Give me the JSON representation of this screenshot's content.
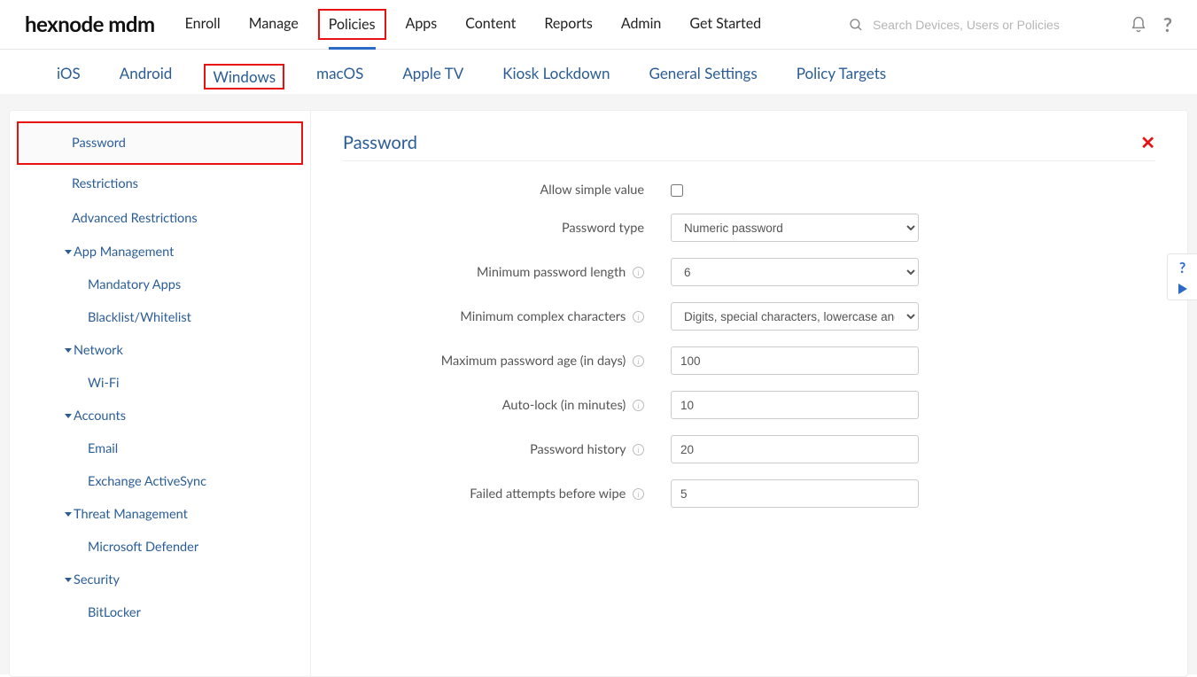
{
  "logo": "hexnode mdm",
  "search": {
    "placeholder": "Search Devices, Users or Policies"
  },
  "mainNav": {
    "items": [
      "Enroll",
      "Manage",
      "Policies",
      "Apps",
      "Content",
      "Reports",
      "Admin",
      "Get Started"
    ],
    "activeIndex": 2,
    "highlightIndex": 2
  },
  "subNav": {
    "items": [
      "iOS",
      "Android",
      "Windows",
      "macOS",
      "Apple TV",
      "Kiosk Lockdown",
      "General Settings",
      "Policy Targets"
    ],
    "activeIndex": 2,
    "highlightIndex": 2
  },
  "sidebar": {
    "topItems": [
      "Password",
      "Restrictions",
      "Advanced Restrictions"
    ],
    "selectedIndex": 0,
    "groups": [
      {
        "label": "App Management",
        "children": [
          "Mandatory Apps",
          "Blacklist/Whitelist"
        ]
      },
      {
        "label": "Network",
        "children": [
          "Wi-Fi"
        ]
      },
      {
        "label": "Accounts",
        "children": [
          "Email",
          "Exchange ActiveSync"
        ]
      },
      {
        "label": "Threat Management",
        "children": [
          "Microsoft Defender"
        ]
      },
      {
        "label": "Security",
        "children": [
          "BitLocker"
        ]
      }
    ]
  },
  "content": {
    "title": "Password",
    "fields": {
      "allowSimple": {
        "label": "Allow simple value",
        "checked": false
      },
      "passwordType": {
        "label": "Password type",
        "value": "Numeric password",
        "options": [
          "Numeric password"
        ]
      },
      "minLength": {
        "label": "Minimum password length",
        "value": "6",
        "options": [
          "6"
        ],
        "info": true
      },
      "minComplex": {
        "label": "Minimum complex characters",
        "value": "Digits, special characters, lowercase and uppercase letters",
        "options": [
          "Digits, special characters, lowercase and uppercase letters"
        ],
        "info": true
      },
      "maxAge": {
        "label": "Maximum password age (in days)",
        "value": "100",
        "info": true
      },
      "autoLock": {
        "label": "Auto-lock (in minutes)",
        "value": "10",
        "info": true
      },
      "history": {
        "label": "Password history",
        "value": "20",
        "info": true
      },
      "failedWipe": {
        "label": "Failed attempts before wipe",
        "value": "5",
        "info": true
      }
    }
  }
}
